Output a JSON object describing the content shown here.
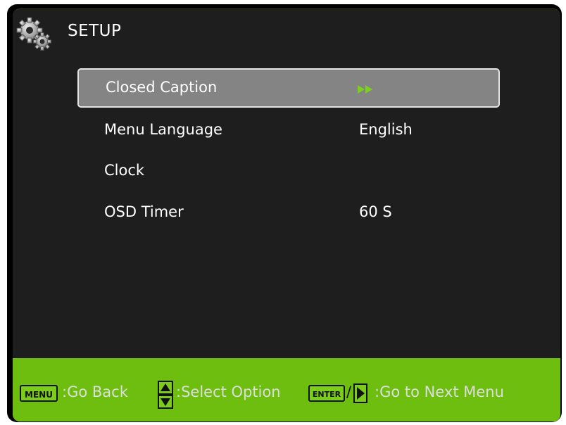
{
  "header": {
    "title": "SETUP",
    "icon": "gear-icon"
  },
  "menu": {
    "items": [
      {
        "label": "Closed Caption",
        "value": "",
        "indicator": "double-arrow-right-icon",
        "selected": true
      },
      {
        "label": "Menu Language",
        "value": "English",
        "selected": false
      },
      {
        "label": "Clock",
        "value": "",
        "selected": false
      },
      {
        "label": "OSD Timer",
        "value": "60 S",
        "selected": false
      }
    ]
  },
  "footer": {
    "menu_key": "MENU",
    "go_back": ":Go Back",
    "select_option": ":Select Option",
    "enter_key": "ENTER",
    "separator": "/",
    "go_next": ":Go to Next Menu"
  },
  "colors": {
    "background": "#1e1e1e",
    "footer": "#6ebe10",
    "selected_row": "#848484",
    "arrow": "#7cd21a"
  }
}
